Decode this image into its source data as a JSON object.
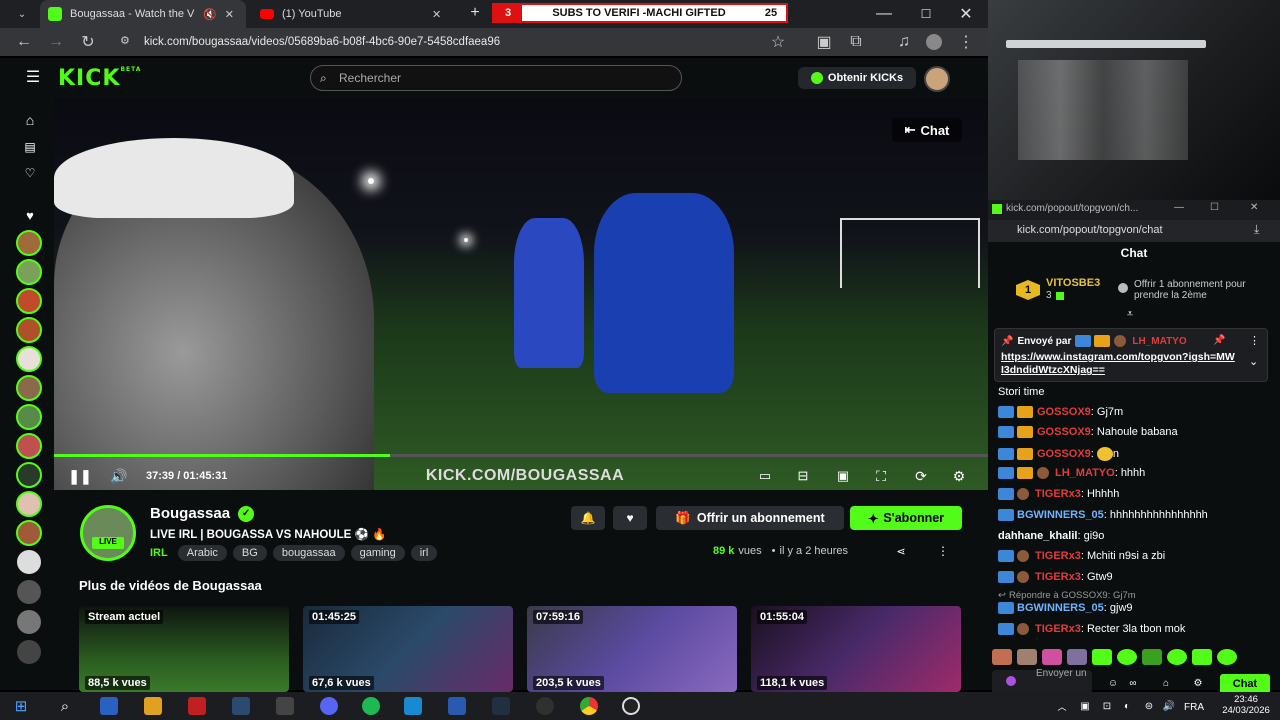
{
  "browser": {
    "tabs": [
      {
        "title": "Bougassaa - Watch the VOD",
        "active": true
      },
      {
        "title": "(1) YouTube",
        "active": false
      }
    ],
    "url": "kick.com/bougassaa/videos/05689ba6-b08f-4bc6-90e7-5458cdfaea96"
  },
  "overlay_banner": {
    "left": "3",
    "text": "SUBS TO VERIFI -MACHI GIFTED",
    "right": "25"
  },
  "header": {
    "logo": "KICK",
    "logo_sup": "BETA",
    "search_placeholder": "Rechercher",
    "get_kicks": "Obtenir KICKs"
  },
  "video": {
    "chat_button": "Chat",
    "time": "37:39 / 01:45:31",
    "progress_fraction": 0.36,
    "watermark": "KICK.COM/BOUGASSAA"
  },
  "channel": {
    "name": "Bougassaa",
    "live_badge": "LIVE",
    "title": "LIVE IRL | BOUGASSA VS NAHOULE ⚽ 🔥",
    "category": "IRL",
    "tags": [
      "Arabic",
      "BG",
      "bougassaa",
      "gaming",
      "irl"
    ],
    "gift_sub": "Offrir un abonnement",
    "subscribe": "S'abonner",
    "views": "89 k",
    "views_label": "vues",
    "time_ago": "il y a 2 heures"
  },
  "more_videos": {
    "heading": "Plus de vidéos de Bougassaa",
    "items": [
      {
        "duration": "Stream actuel",
        "views": "88,5 k vues"
      },
      {
        "duration": "01:45:25",
        "views": "67,6 k vues"
      },
      {
        "duration": "07:59:16",
        "views": "203,5 k vues"
      },
      {
        "duration": "01:55:04",
        "views": "118,1 k vues"
      }
    ]
  },
  "popout": {
    "window_title": "kick.com/popout/topgvon/ch...",
    "url": "kick.com/popout/topgvon/chat",
    "header": "Chat",
    "gifter": {
      "rank": "1",
      "name": "VITOSBE3",
      "count": "3",
      "promo": "Offrir 1 abonnement pour prendre la 2ème"
    },
    "pinned": {
      "sent_by": "Envoyé par",
      "user": "LH_MATYO",
      "link": "https://www.instagram.com/topgvon?igsh=MWI3dndidWtzcXNjag=="
    },
    "messages": [
      {
        "user": "",
        "text": "Stori time",
        "type": "plain"
      },
      {
        "user": "GOSSOX9",
        "text": "Gj7m",
        "type": "red"
      },
      {
        "user": "GOSSOX9",
        "text": "Nahoule babana",
        "type": "red"
      },
      {
        "user": "GOSSOX9",
        "text": "n",
        "type": "red"
      },
      {
        "user": "LH_MATYO",
        "text": "hhhh",
        "type": "red"
      },
      {
        "user": "TIGERx3",
        "text": "Hhhhh",
        "type": "red"
      },
      {
        "user": "BGWINNERS_05",
        "text": "hhhhhhhhhhhhhhhh",
        "type": "blue"
      },
      {
        "user": "dahhane_khalil",
        "text": "gi9o",
        "type": "white"
      },
      {
        "user": "TIGERx3",
        "text": "Mchiti n9si a zbi",
        "type": "red"
      },
      {
        "user": "TIGERx3",
        "text": "Gtw9",
        "type": "red"
      },
      {
        "reply": "Répondre à GOSSOX9: Gj7m"
      },
      {
        "user": "BGWINNERS_05",
        "text": "gjw9",
        "type": "blue"
      },
      {
        "user": "TIGERx3",
        "text": "Recter 3la tbon mok",
        "type": "red"
      }
    ],
    "input_placeholder": "Envoyer un",
    "chat_send": "Chat"
  },
  "taskbar": {
    "language": "FRA",
    "time": "23:46",
    "date": "24/03/2026"
  },
  "colors": {
    "kick_green": "#53fc18",
    "username_red": "#e33b3b",
    "username_blue": "#6fb3ff"
  }
}
